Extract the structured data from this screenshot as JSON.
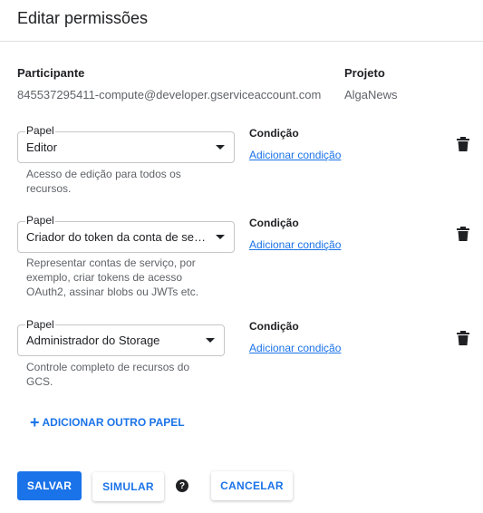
{
  "dialog": {
    "title": "Editar permissões"
  },
  "header": {
    "participant_label": "Participante",
    "participant_value": "845537295411-compute@developer.gserviceaccount.com",
    "project_label": "Projeto",
    "project_value": "AlgaNews"
  },
  "roles": [
    {
      "field_label": "Papel",
      "value": "Editor",
      "helper_lines": [
        "Acesso de edição para todos os",
        "recursos."
      ],
      "condition_label": "Condição",
      "condition_link": "Adicionar condição"
    },
    {
      "field_label": "Papel",
      "value": "Criador do token da conta de ser...",
      "helper_lines": [
        "Representar contas de serviço, por",
        "exemplo, criar tokens de acesso",
        "OAuth2, assinar blobs ou JWTs etc."
      ],
      "condition_label": "Condição",
      "condition_link": "Adicionar condição"
    },
    {
      "field_label": "Papel",
      "value": "Administrador do Storage",
      "helper_lines": [
        "Controle completo de recursos do",
        "GCS."
      ],
      "condition_label": "Condição",
      "condition_link": "Adicionar condição"
    }
  ],
  "add_role": {
    "icon": "plus-icon",
    "label": "ADICIONAR OUTRO PAPEL"
  },
  "footer": {
    "save_label": "SALVAR",
    "simulate_label": "SIMULAR",
    "help_icon": "?",
    "cancel_label": "CANCELAR"
  },
  "colors": {
    "accent": "#1a73e8",
    "text": "#202124",
    "muted": "#5f6368"
  }
}
